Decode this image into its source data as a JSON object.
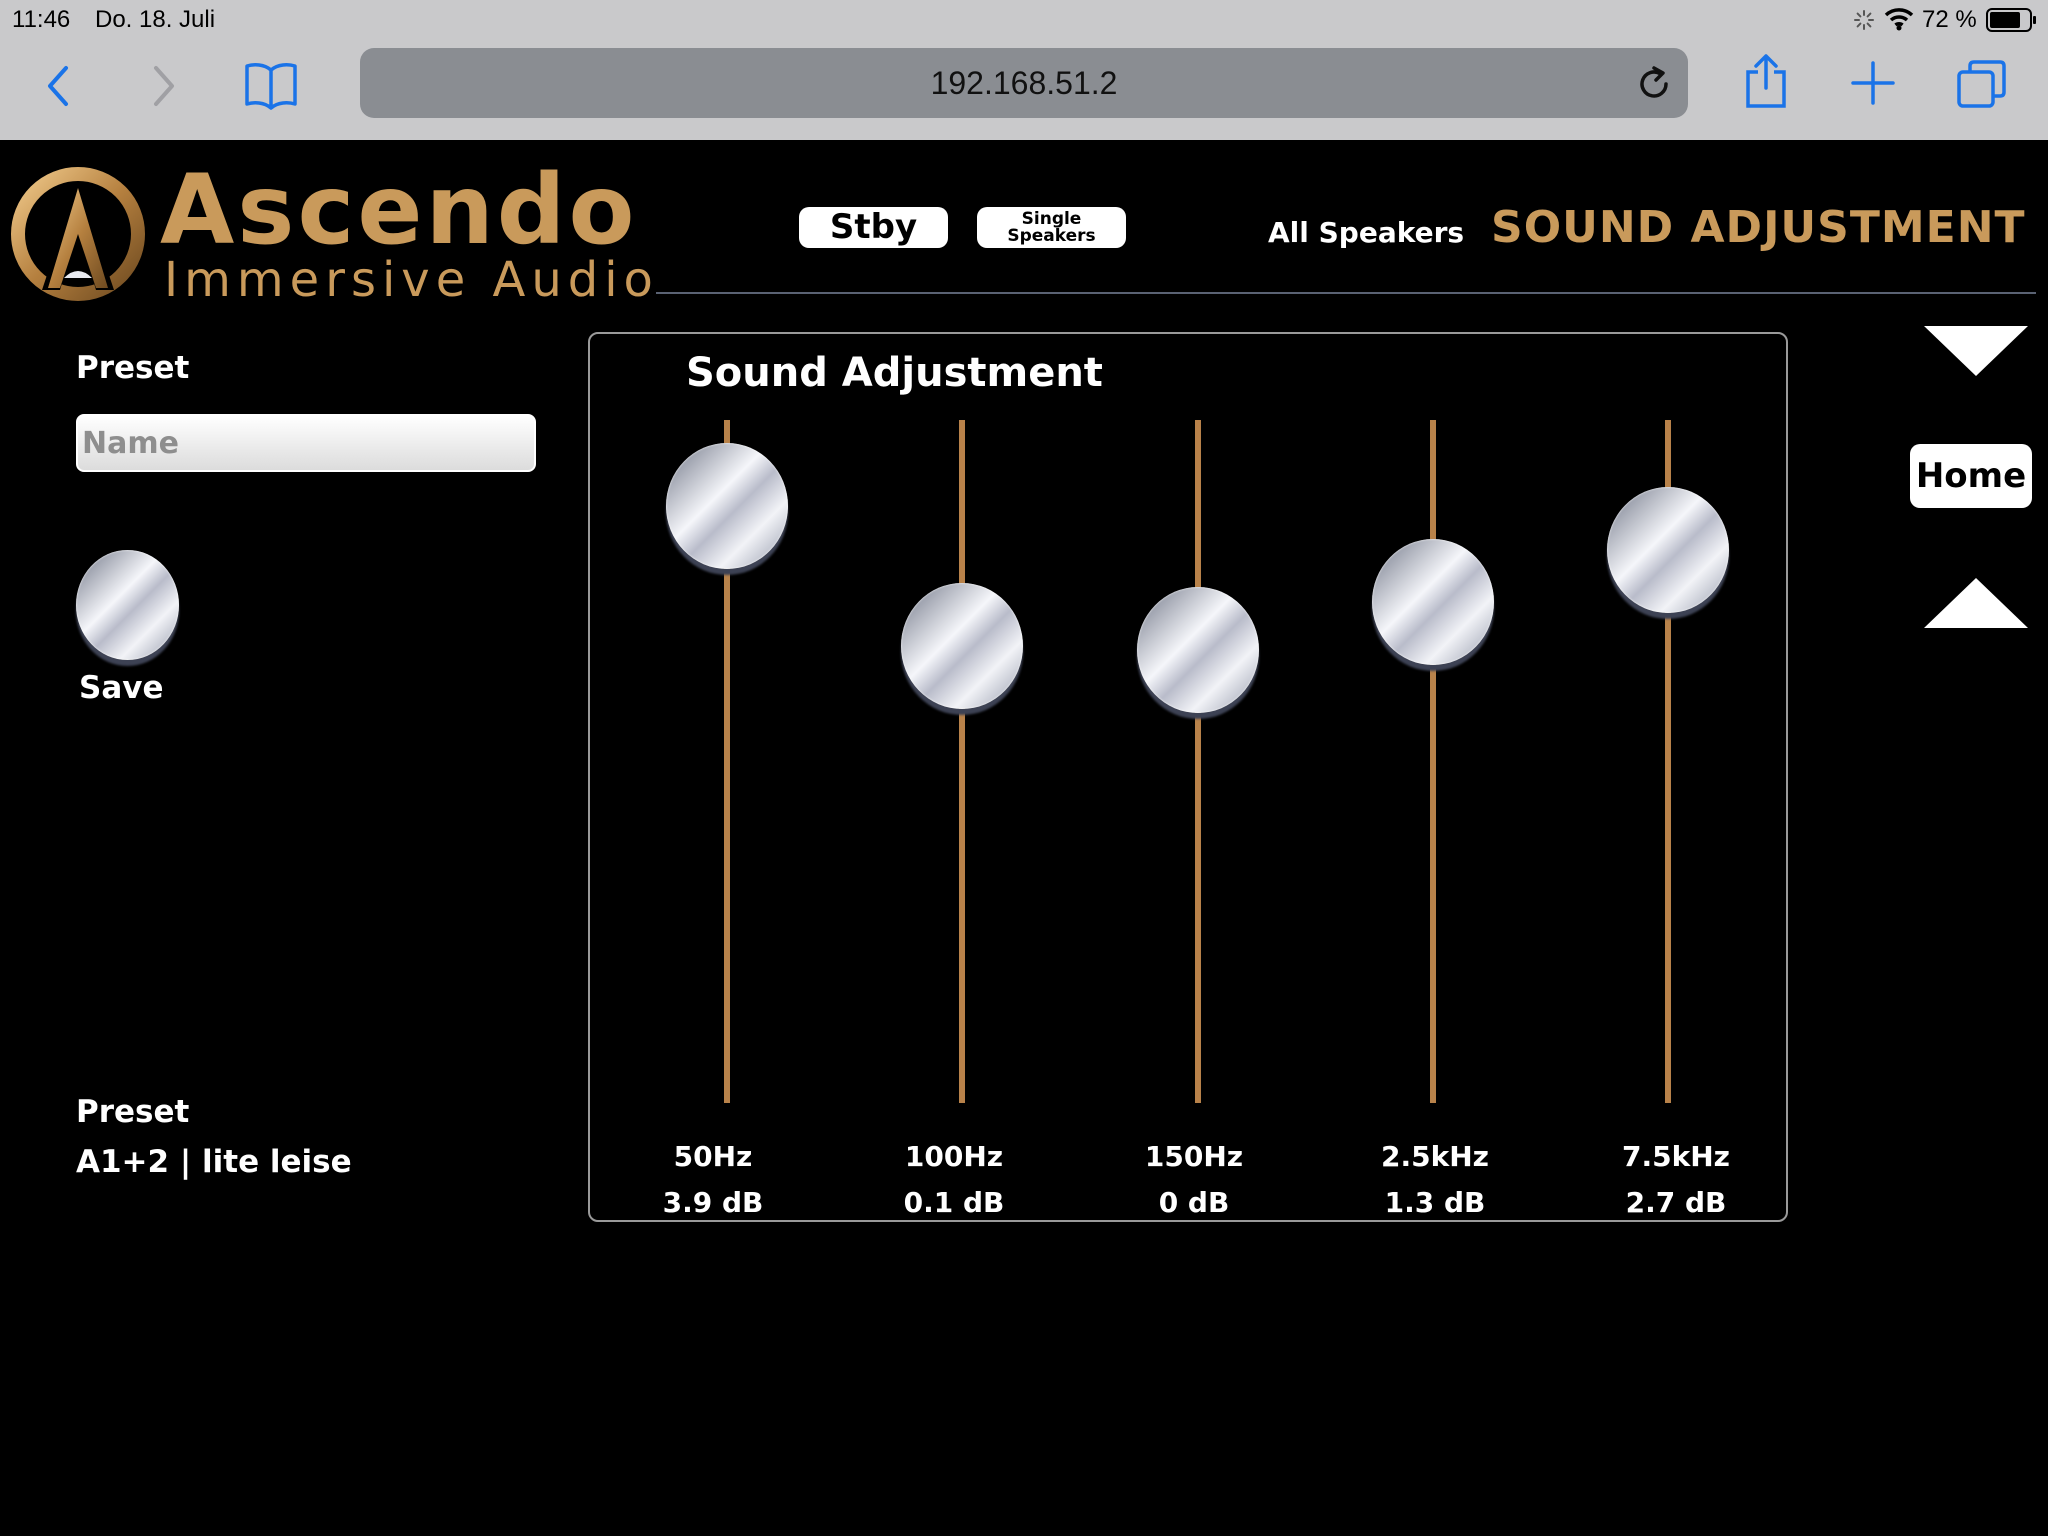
{
  "status_bar": {
    "time": "11:46",
    "date": "Do. 18. Juli",
    "battery": "72 %"
  },
  "browser": {
    "url": "192.168.51.2"
  },
  "brand": {
    "name": "Ascendo",
    "tagline": "Immersive Audio"
  },
  "header": {
    "stby_label": "Stby",
    "single_speakers_label_1": "Single",
    "single_speakers_label_2": "Speakers",
    "scope_label": "All Speakers",
    "page_title": "SOUND ADJUSTMENT"
  },
  "preset_panel": {
    "label": "Preset",
    "name_placeholder": "Name",
    "save_label": "Save",
    "current_label": "Preset",
    "current_value": "A1+2 | lite leise"
  },
  "eq": {
    "title": "Sound Adjustment",
    "bands": [
      {
        "label": "50Hz",
        "value": "3.9 dB",
        "db": 3.9
      },
      {
        "label": "100Hz",
        "value": "0.1 dB",
        "db": 0.1
      },
      {
        "label": "150Hz",
        "value": "0 dB",
        "db": 0
      },
      {
        "label": "2.5kHz",
        "value": "1.3 dB",
        "db": 1.3
      },
      {
        "label": "7.5kHz",
        "value": "2.7 dB",
        "db": 2.7
      }
    ]
  },
  "nav": {
    "home_label": "Home"
  },
  "colors": {
    "accent": "#c99a5b",
    "track": "#b8824a",
    "background": "#000000"
  }
}
